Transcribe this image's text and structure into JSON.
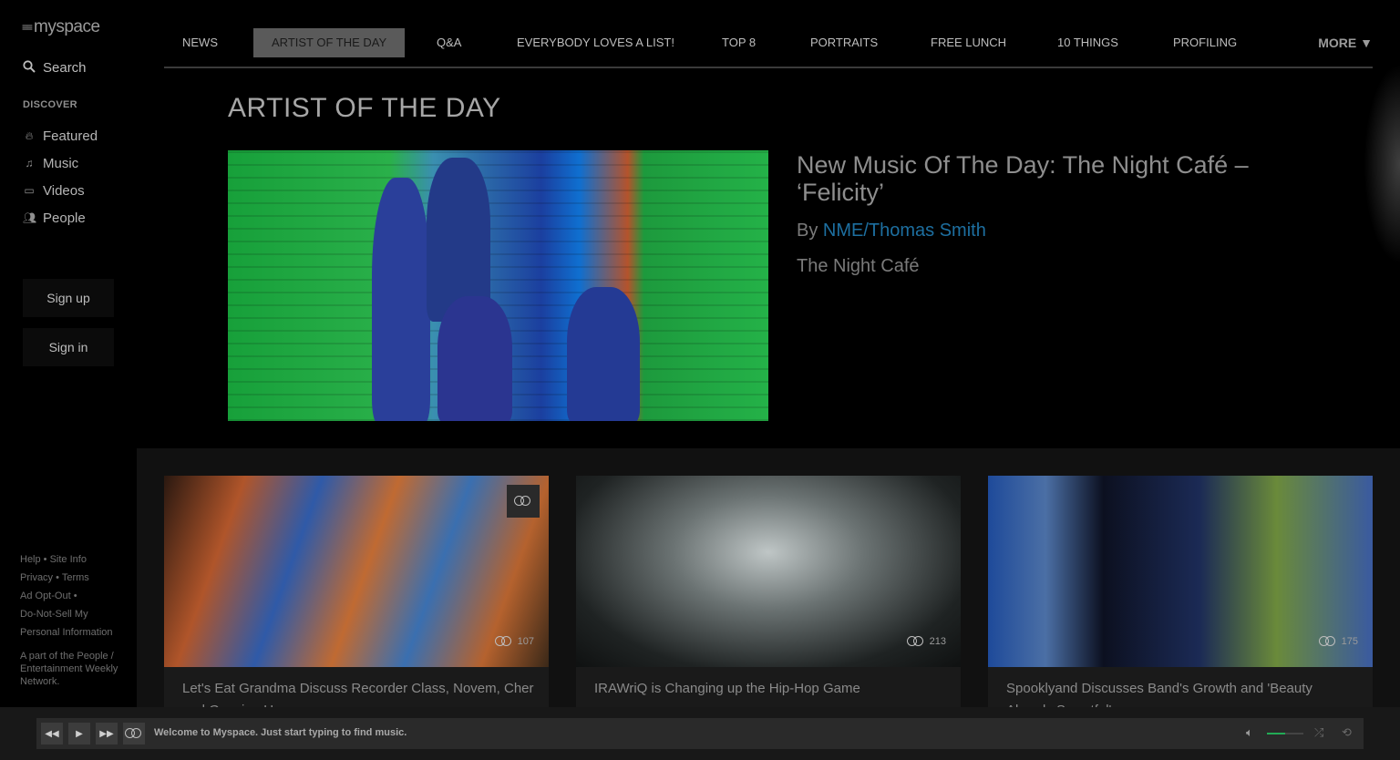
{
  "brand": {
    "logo_text": "myspace",
    "logo_mark": "≡≡"
  },
  "sidebar": {
    "search_label": "Search",
    "discover_heading": "DISCOVER",
    "nav": [
      {
        "label": "Featured",
        "icon": "flame-icon"
      },
      {
        "label": "Music",
        "icon": "music-note-icon"
      },
      {
        "label": "Videos",
        "icon": "video-icon"
      },
      {
        "label": "People",
        "icon": "people-icon"
      }
    ],
    "signup_label": "Sign up",
    "signin_label": "Sign in",
    "footer_links": [
      "Help",
      "Site Info",
      "Privacy",
      "Terms",
      "Ad Opt-Out",
      "Do-Not-Sell My Personal Information"
    ],
    "footer_note": "A part of the People / Entertainment Weekly Network."
  },
  "topnav": {
    "tabs": [
      "NEWS",
      "ARTIST OF THE DAY",
      "Q&A",
      "EVERYBODY LOVES A LIST!",
      "TOP 8",
      "PORTRAITS",
      "FREE LUNCH",
      "10 THINGS",
      "PROFILING"
    ],
    "active_tab": "ARTIST OF THE DAY",
    "more_label": "MORE ▼"
  },
  "page": {
    "title": "ARTIST OF THE DAY",
    "hero": {
      "headline": "New Music Of The Day: The Night Café – ‘Felicity’",
      "by_prefix": "By",
      "author": "NME/Thomas Smith",
      "subtitle": "The Night Café"
    },
    "cards": [
      {
        "title": "Let's Eat Grandma Discuss Recorder Class, Novem, Cher and Growing Up",
        "count": "107"
      },
      {
        "title": "IRAWriQ is Changing up the Hip-Hop Game",
        "count": "213"
      },
      {
        "title": "Spooklyand Discusses Band's Growth and 'Beauty Already Sweetful'",
        "count": "175"
      }
    ]
  },
  "player": {
    "message": "Welcome to Myspace. Just start typing to find music.",
    "volume_fraction": 0.5
  },
  "colors": {
    "accent_link": "#1d6fa0",
    "volume_fill": "#22aa55"
  }
}
